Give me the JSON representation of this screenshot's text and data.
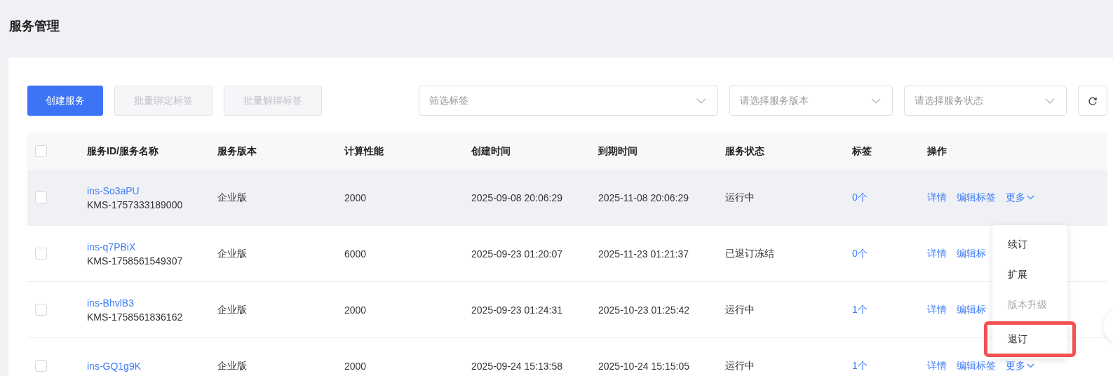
{
  "page_title": "服务管理",
  "toolbar": {
    "buttons": [
      {
        "label": "创建服务",
        "disabled": false
      },
      {
        "label": "批量绑定标签",
        "disabled": true
      },
      {
        "label": "批量解绑标签",
        "disabled": true
      }
    ],
    "filters": [
      {
        "placeholder": "筛选标签"
      },
      {
        "placeholder": "请选择服务版本"
      },
      {
        "placeholder": "请选择服务状态"
      }
    ]
  },
  "table": {
    "columns": [
      "服务ID/服务名称",
      "服务版本",
      "计算性能",
      "创建时间",
      "到期时间",
      "服务状态",
      "标签",
      "操作"
    ],
    "header_checked": false,
    "rows": [
      {
        "id": "ins-So3aPU",
        "name": "KMS-1757333189000",
        "version": "企业版",
        "performance": "2000",
        "created": "2025-09-08 20:06:29",
        "expires": "2025-11-08 20:06:29",
        "status": "运行中",
        "tags": "0个",
        "actions": [
          "详情",
          "编辑标签"
        ],
        "more": "更多",
        "hovered": true,
        "checked": false
      },
      {
        "id": "ins-q7PBiX",
        "name": "KMS-1758561549307",
        "version": "企业版",
        "performance": "6000",
        "created": "2025-09-23 01:20:07",
        "expires": "2025-11-23 01:21:37",
        "status": "已退订冻结",
        "tags": "0个",
        "actions": [
          "详情",
          "编辑标"
        ],
        "hovered": false,
        "checked": false
      },
      {
        "id": "ins-BhvlB3",
        "name": "KMS-1758561836162",
        "version": "企业版",
        "performance": "2000",
        "created": "2025-09-23 01:24:31",
        "expires": "2025-10-23 01:25:42",
        "status": "运行中",
        "tags": "1个",
        "actions": [
          "详情",
          "编辑标"
        ],
        "hovered": false,
        "checked": false
      },
      {
        "id": "ins-GQ1g9K",
        "version": "企业版",
        "performance": "2000",
        "created": "2025-09-24 15:13:58",
        "expires": "2025-10-24 15:15:05",
        "status": "运行中",
        "tags": "1个",
        "actions": [
          "详情",
          "编辑标签"
        ],
        "more": "更多",
        "hovered": false,
        "checked": false
      }
    ]
  },
  "more_menu": {
    "items": [
      {
        "label": "续订",
        "disabled": false,
        "highlighted": false
      },
      {
        "label": "扩展",
        "disabled": false,
        "highlighted": false
      },
      {
        "label": "版本升级",
        "disabled": true,
        "highlighted": false
      },
      {
        "label": "退订",
        "disabled": false,
        "highlighted": true
      }
    ]
  }
}
